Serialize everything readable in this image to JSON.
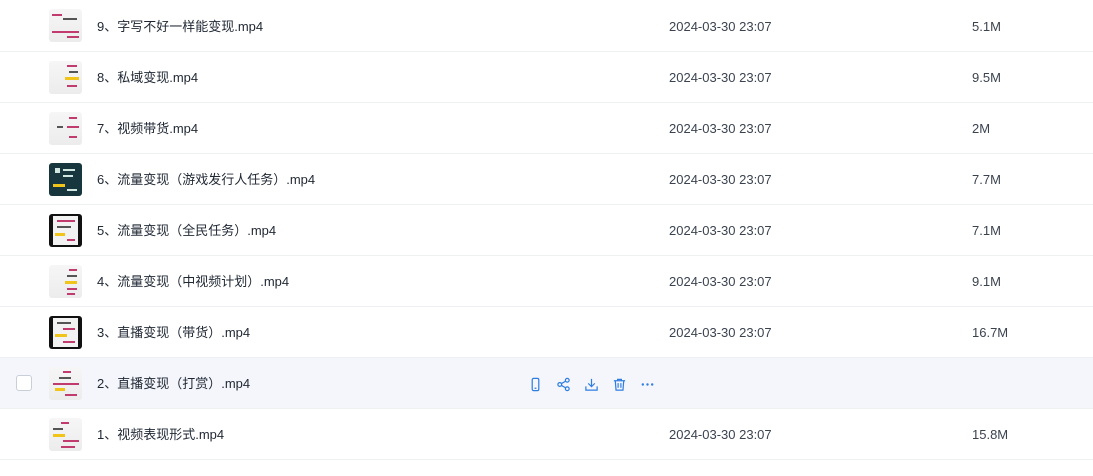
{
  "files": [
    {
      "name": "9、字写不好一样能变现.mp4",
      "modified": "2024-03-30 23:07",
      "size": "5.1M",
      "thumb": "light"
    },
    {
      "name": "8、私域变现.mp4",
      "modified": "2024-03-30 23:07",
      "size": "9.5M",
      "thumb": "light"
    },
    {
      "name": "7、视频带货.mp4",
      "modified": "2024-03-30 23:07",
      "size": "2M",
      "thumb": "light"
    },
    {
      "name": "6、流量变现（游戏发行人任务）.mp4",
      "modified": "2024-03-30 23:07",
      "size": "7.7M",
      "thumb": "dark"
    },
    {
      "name": "5、流量变现（全民任务）.mp4",
      "modified": "2024-03-30 23:07",
      "size": "7.1M",
      "thumb": "black"
    },
    {
      "name": "4、流量变现（中视频计划）.mp4",
      "modified": "2024-03-30 23:07",
      "size": "9.1M",
      "thumb": "light"
    },
    {
      "name": "3、直播变现（带货）.mp4",
      "modified": "2024-03-30 23:07",
      "size": "16.7M",
      "thumb": "black"
    },
    {
      "name": "2、直播变现（打赏）.mp4",
      "modified": "",
      "size": "",
      "thumb": "light",
      "hovered": true
    },
    {
      "name": "1、视频表现形式.mp4",
      "modified": "2024-03-30 23:07",
      "size": "15.8M",
      "thumb": "light"
    }
  ],
  "row_actions": [
    {
      "icon": "phone-icon",
      "label": ""
    },
    {
      "icon": "share-icon",
      "label": ""
    },
    {
      "icon": "download-icon",
      "label": ""
    },
    {
      "icon": "delete-icon",
      "label": ""
    },
    {
      "icon": "more-icon",
      "label": ""
    }
  ],
  "colors": {
    "accent": "#2f7de1",
    "hover_row": "#f4f6fb",
    "divider": "#eef0f3"
  }
}
